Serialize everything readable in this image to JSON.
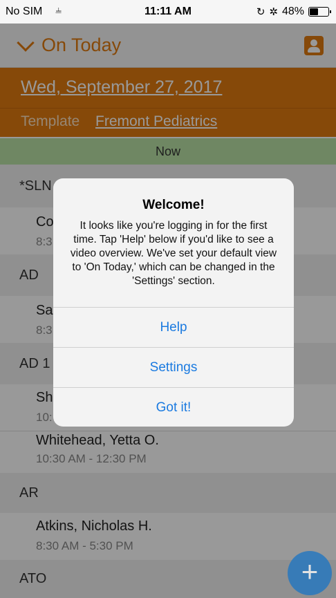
{
  "status": {
    "carrier": "No SIM",
    "time": "11:11 AM",
    "battery": "48%",
    "battery_level": 0.48
  },
  "nav": {
    "title": "On Today"
  },
  "header": {
    "date": "Wed, September 27, 2017",
    "template_label": "Template",
    "template_value": "Fremont Pediatrics"
  },
  "now_label": "Now",
  "list": {
    "sections": [
      "*SLN",
      "AD",
      "AD 1",
      "AR",
      "ATO"
    ],
    "rows": [
      {
        "name": "Co",
        "time": "8:3"
      },
      {
        "name": "Sa",
        "time": "8:3"
      },
      {
        "name": "Sh",
        "time": "10:"
      },
      {
        "name": "Whitehead, Yetta O.",
        "time": "10:30 AM - 12:30 PM"
      },
      {
        "name": "Atkins, Nicholas H.",
        "time": "8:30 AM - 5:30 PM"
      }
    ]
  },
  "alert": {
    "title": "Welcome!",
    "message": "It looks like you're logging in for the first time. Tap 'Help' below if you'd like to see a video overview. We've set your default view to 'On Today,' which can be changed in the 'Settings' section.",
    "buttons": [
      "Help",
      "Settings",
      "Got it!"
    ]
  },
  "fab_label": "+"
}
